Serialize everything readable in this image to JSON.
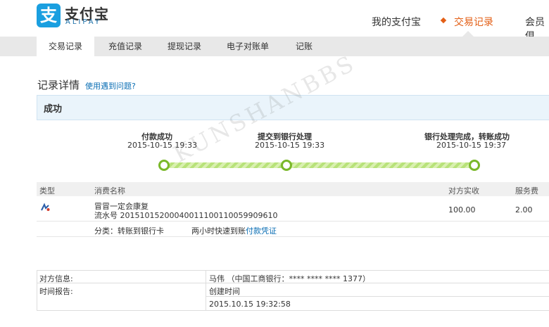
{
  "header": {
    "logo_char": "支",
    "logo_cn": "支付宝",
    "logo_en": "ALIPAY",
    "nav": {
      "my_alipay": "我的支付宝",
      "trade_records": "交易记录",
      "member": "会员俱"
    }
  },
  "subnav": [
    "交易记录",
    "充值记录",
    "提现记录",
    "电子对账单",
    "记账"
  ],
  "detail": {
    "title": "记录详情",
    "help_link": "使用遇到问题?",
    "status": "成功"
  },
  "steps": [
    {
      "title": "付款成功",
      "time": "2015-10-15 19:33"
    },
    {
      "title": "提交到银行处理",
      "time": "2015-10-15 19:33"
    },
    {
      "title": "银行处理完成，转账成功",
      "time": "2015-10-15 19:37"
    }
  ],
  "table": {
    "headers": {
      "type": "类型",
      "name": "消费名称",
      "amount": "对方实收",
      "fee": "服务费"
    },
    "row": {
      "name": "冒冒一定会康复",
      "serial": "流水号 20151015200040011100110059909610",
      "amount": "100.00",
      "fee": "2.00",
      "category": "分类：转账到银行卡",
      "speed": "两小时快速到账",
      "voucher_link": "付款凭证"
    }
  },
  "info": {
    "counterparty_label": "对方信息:",
    "counterparty_value": "马伟 （中国工商银行：**** **** **** 1377）",
    "time_label": "时间报告:",
    "created_label": "创建时间",
    "created_value": "2015.10.15 19:32:58"
  },
  "watermark": "KUNSHANBBS",
  "colors": {
    "accent": "#e35f16",
    "brand": "#1a9fe0",
    "link": "#0a6eb4",
    "progress": "#7ab829"
  }
}
